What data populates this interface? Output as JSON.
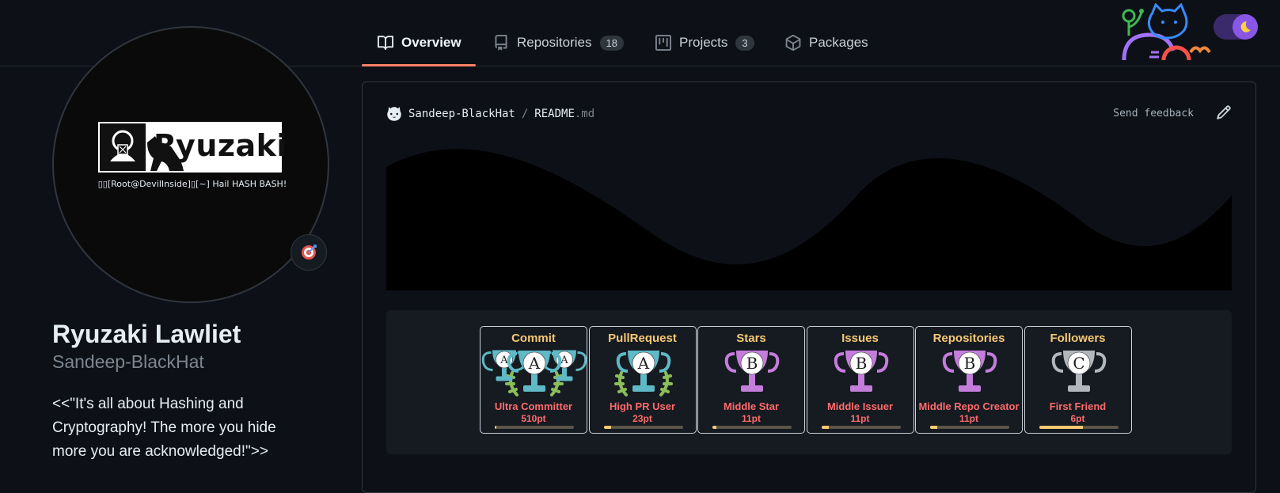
{
  "nav": {
    "tabs": [
      {
        "label": "Overview",
        "icon": "book-icon",
        "active": true
      },
      {
        "label": "Repositories",
        "icon": "repo-icon",
        "count": "18"
      },
      {
        "label": "Projects",
        "icon": "project-icon",
        "count": "3"
      },
      {
        "label": "Packages",
        "icon": "package-icon"
      }
    ],
    "theme": "dark"
  },
  "profile": {
    "logo_text": "Ryuzaki",
    "avatar_tagline": "▯▯[Root@DevilInside]▯[~] Hail HASH BASH!",
    "status_icon": "target-emoji",
    "full_name": "Ryuzaki Lawliet",
    "username": "Sandeep-BlackHat",
    "bio": "<<\"It's all about Hashing and Cryptography! The more you hide more you are acknowledged!\">>"
  },
  "readme": {
    "owner": "Sandeep-BlackHat",
    "separator": "/",
    "file_base": "README",
    "file_ext": ".md",
    "feedback": "Send feedback"
  },
  "trophies": [
    {
      "title": "Commit",
      "rank": "A",
      "name": "Ultra Committer",
      "points": "510pt",
      "progress": 0.02,
      "color": "#5fb9c6",
      "laurel": true,
      "multi": true
    },
    {
      "title": "PullRequest",
      "rank": "A",
      "name": "High PR User",
      "points": "23pt",
      "progress": 0.09,
      "color": "#5fb9c6",
      "laurel": true,
      "multi": false
    },
    {
      "title": "Stars",
      "rank": "B",
      "name": "Middle Star",
      "points": "11pt",
      "progress": 0.05,
      "color": "#c57ddc",
      "laurel": false,
      "multi": false
    },
    {
      "title": "Issues",
      "rank": "B",
      "name": "Middle Issuer",
      "points": "11pt",
      "progress": 0.09,
      "color": "#c57ddc",
      "laurel": false,
      "multi": false
    },
    {
      "title": "Repositories",
      "rank": "B",
      "name": "Middle Repo Creator",
      "points": "11pt",
      "progress": 0.09,
      "color": "#c57ddc",
      "laurel": false,
      "multi": false
    },
    {
      "title": "Followers",
      "rank": "C",
      "name": "First Friend",
      "points": "6pt",
      "progress": 0.55,
      "color": "#b2b6bd",
      "laurel": false,
      "multi": false
    }
  ]
}
